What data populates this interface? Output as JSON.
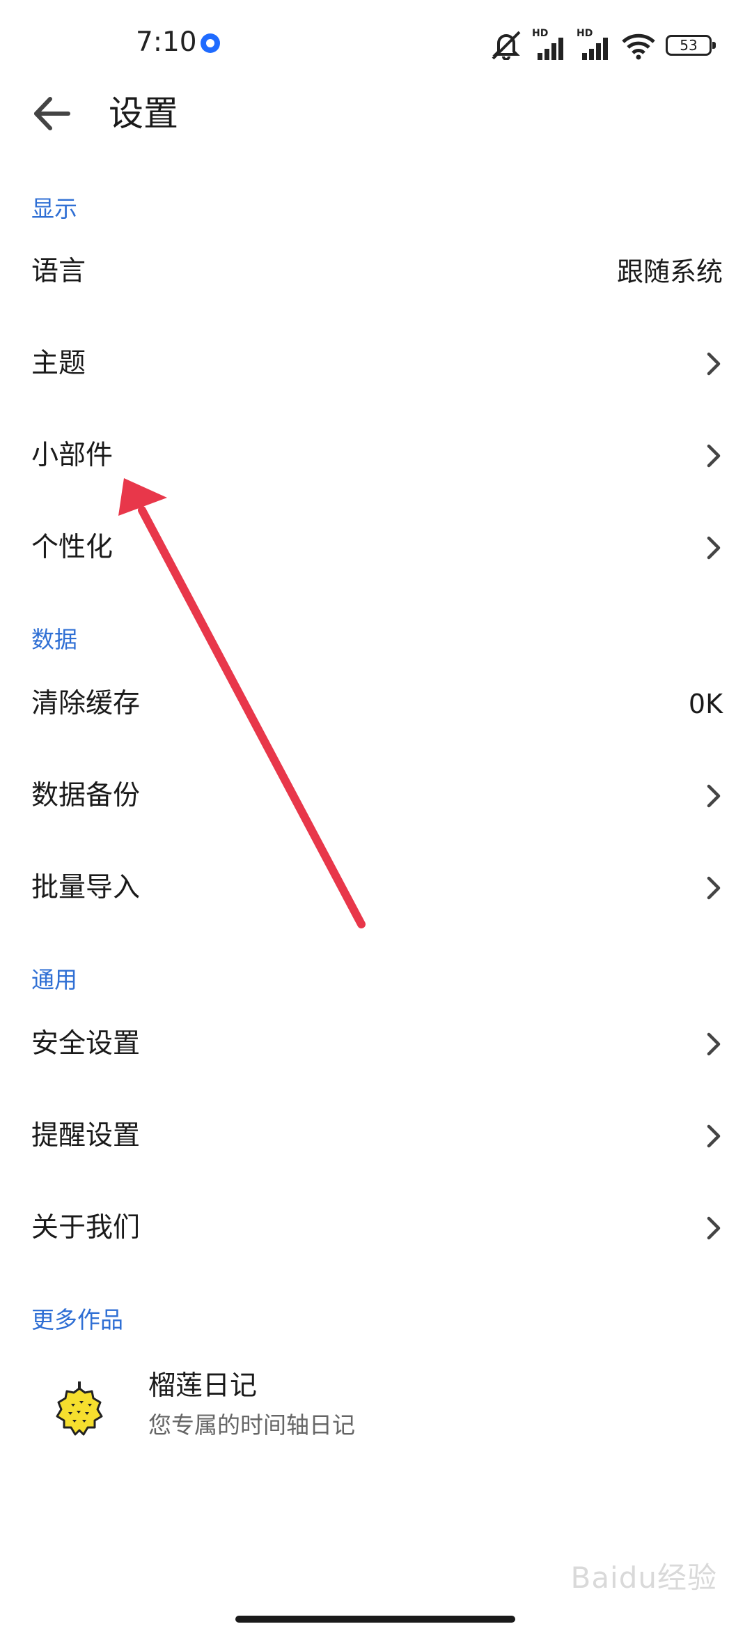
{
  "status_bar": {
    "time": "7:10",
    "hd_label": "HD",
    "battery": "53",
    "icons": [
      "mute-icon",
      "signal-hd-icon",
      "signal-hd-icon",
      "wifi-icon",
      "battery-icon"
    ]
  },
  "header": {
    "back_icon": "arrow-left-icon",
    "title": "设置"
  },
  "sections": {
    "display": {
      "title": "显示",
      "language": {
        "label": "语言",
        "value": "跟随系统"
      },
      "theme": {
        "label": "主题"
      },
      "widget": {
        "label": "小部件"
      },
      "personalize": {
        "label": "个性化"
      }
    },
    "data": {
      "title": "数据",
      "clear_cache": {
        "label": "清除缓存",
        "value": "0K"
      },
      "backup": {
        "label": "数据备份"
      },
      "batch_import": {
        "label": "批量导入"
      }
    },
    "general": {
      "title": "通用",
      "security": {
        "label": "安全设置"
      },
      "reminder": {
        "label": "提醒设置"
      },
      "about": {
        "label": "关于我们"
      }
    },
    "more_works": {
      "title": "更多作品",
      "app_name": "榴莲日记",
      "app_desc": "您专属的时间轴日记",
      "app_icon": "durian-icon"
    }
  },
  "watermark": "Baidu经验",
  "colors": {
    "section_title": "#2f6fd4",
    "annotation_arrow": "#e8374a"
  }
}
